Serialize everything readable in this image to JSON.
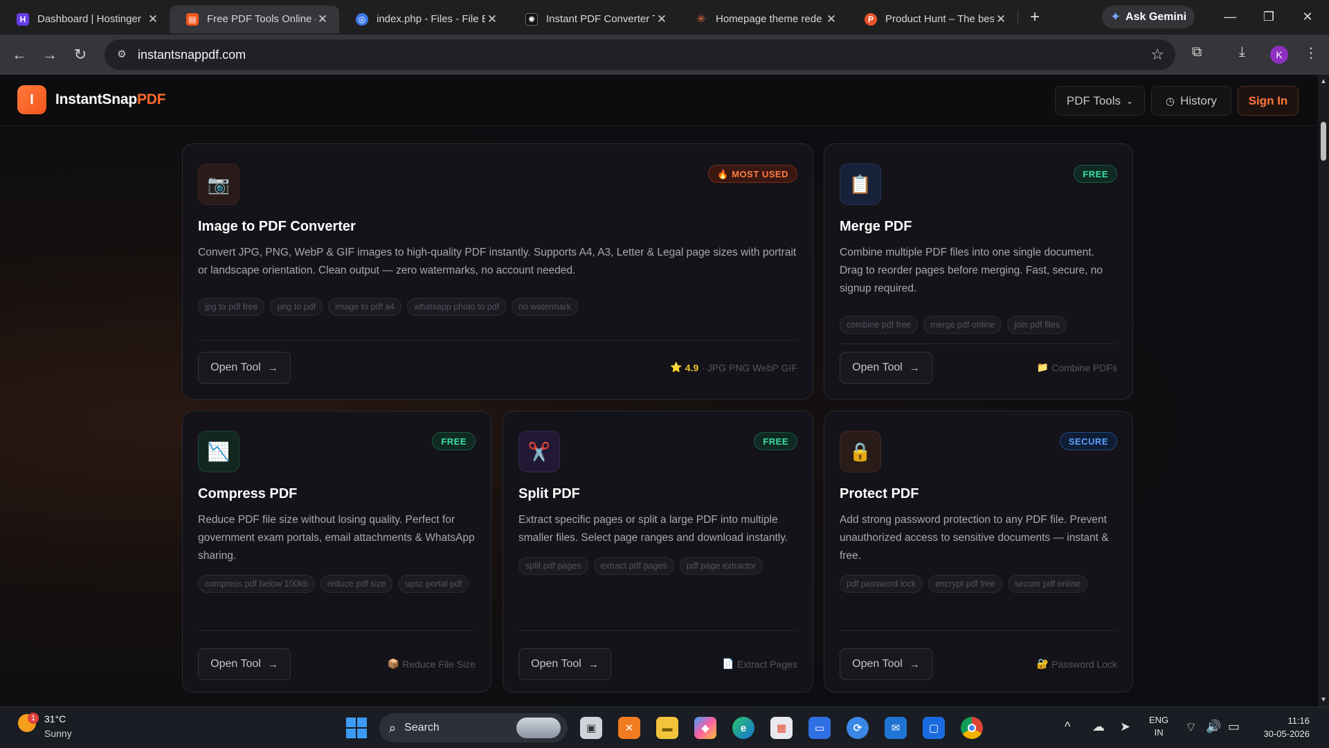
{
  "browser": {
    "tabs": [
      {
        "title": "Dashboard | Hostinger",
        "favicon": "hostinger-icon",
        "color": "#673de6",
        "glyph": "H"
      },
      {
        "title": "Free PDF Tools Online –",
        "favicon": "instantsnappdf-icon",
        "color": "#f4561c",
        "glyph": "▤"
      },
      {
        "title": "index.php - Files - File B",
        "favicon": "filemanager-icon",
        "color": "#3b78e7",
        "glyph": "◎"
      },
      {
        "title": "Instant PDF Converter T",
        "favicon": "openai-icon",
        "color": "#111111",
        "glyph": "✺"
      },
      {
        "title": "Homepage theme rede",
        "favicon": "claude-icon",
        "color": "#d9663f",
        "glyph": "✳"
      },
      {
        "title": "Product Hunt – The bes",
        "favicon": "producthunt-icon",
        "color": "#ea532a",
        "glyph": "P"
      }
    ],
    "active_tab": 1,
    "new_tab": "+",
    "ask_gemini": "Ask Gemini",
    "url": "instantsnappdf.com",
    "profile_initial": "K"
  },
  "site": {
    "brand_main": "InstantSnap",
    "brand_accent": "PDF",
    "logo_letter": "I",
    "nav": {
      "pdf_tools": "PDF Tools",
      "history": "History",
      "sign_in": "Sign In"
    }
  },
  "cards": [
    {
      "icon": "camera-icon",
      "glyph": "📷",
      "icon_bg": "#2a1a1a",
      "badge": "🔥 MOST USED",
      "badge_kind": "hot",
      "title": "Image to PDF Converter",
      "desc": "Convert JPG, PNG, WebP & GIF images to high-quality PDF instantly. Supports A4, A3, Letter & Legal page sizes with portrait or landscape orientation. Clean output — zero watermarks, no account needed.",
      "tags": [
        "jpg to pdf free",
        "png to pdf",
        "image to pdf a4",
        "whatsapp photo to pdf",
        "no watermark"
      ],
      "open": "Open Tool",
      "rating": "4.9",
      "meta": "· JPG PNG WebP GIF",
      "meta_icon": "⭐"
    },
    {
      "icon": "clipboard-icon",
      "glyph": "📋",
      "icon_bg": "#18213a",
      "badge": "FREE",
      "badge_kind": "free",
      "title": "Merge PDF",
      "desc": "Combine multiple PDF files into one single document. Drag to reorder pages before merging. Fast, secure, no signup required.",
      "tags": [
        "combine pdf free",
        "merge pdf online",
        "join pdf files"
      ],
      "open": "Open Tool",
      "meta": "Combine PDFs",
      "meta_icon": "📁"
    },
    {
      "icon": "chart-down-icon",
      "glyph": "📉",
      "icon_bg": "#12281f",
      "badge": "FREE",
      "badge_kind": "free",
      "title": "Compress PDF",
      "desc": "Reduce PDF file size without losing quality. Perfect for government exam portals, email attachments & WhatsApp sharing.",
      "tags": [
        "compress pdf below 100kb",
        "reduce pdf size",
        "upsc portal pdf"
      ],
      "open": "Open Tool",
      "meta": "Reduce File Size",
      "meta_icon": "📦"
    },
    {
      "icon": "scissors-icon",
      "glyph": "✂️",
      "icon_bg": "#221a34",
      "badge": "FREE",
      "badge_kind": "free",
      "title": "Split PDF",
      "desc": "Extract specific pages or split a large PDF into multiple smaller files. Select page ranges and download instantly.",
      "tags": [
        "split pdf pages",
        "extract pdf pages",
        "pdf page extractor"
      ],
      "open": "Open Tool",
      "meta": "Extract Pages",
      "meta_icon": "📄"
    },
    {
      "icon": "lock-icon",
      "glyph": "🔒",
      "icon_bg": "#2a1c18",
      "badge": "SECURE",
      "badge_kind": "sec",
      "title": "Protect PDF",
      "desc": "Add strong password protection to any PDF file. Prevent unauthorized access to sensitive documents — instant & free.",
      "tags": [
        "pdf password lock",
        "encrypt pdf free",
        "secure pdf online"
      ],
      "open": "Open Tool",
      "meta": "Password Lock",
      "meta_icon": "🔐"
    }
  ],
  "taskbar": {
    "weather_badge": "1",
    "temp": "31°C",
    "condition": "Sunny",
    "search": "Search",
    "lang_top": "ENG",
    "lang_bottom": "IN",
    "time": "11:16",
    "date": "30-05-2026"
  }
}
